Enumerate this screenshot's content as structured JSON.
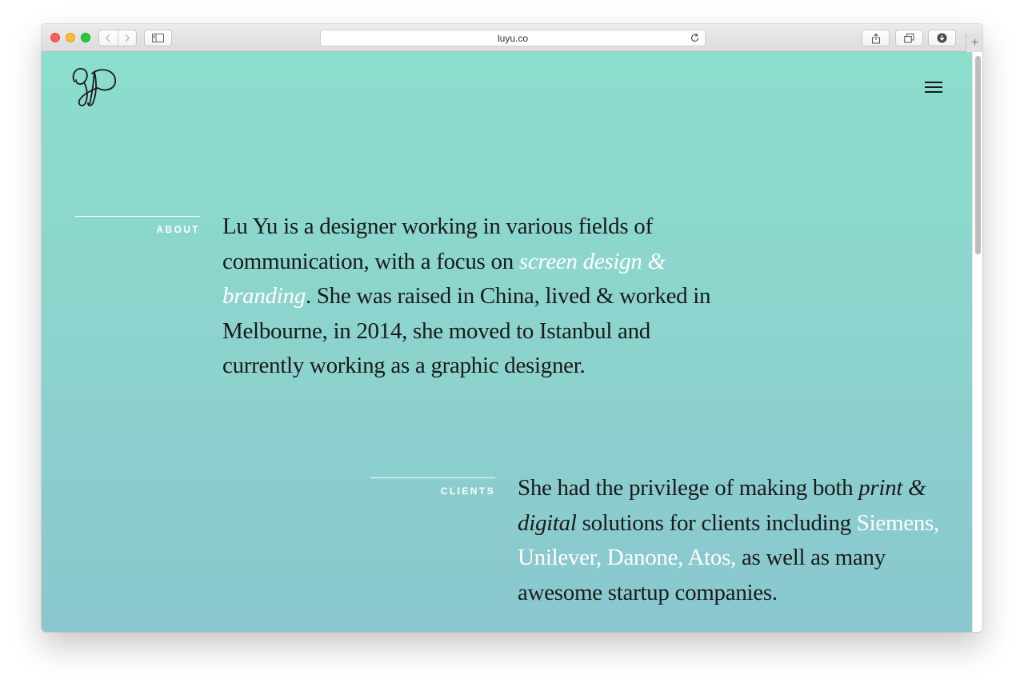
{
  "browser": {
    "url": "luyu.co",
    "new_tab_symbol": "+"
  },
  "site": {
    "menu_icon": "hamburger-menu-icon",
    "logo_icon": "monogram-logo-icon"
  },
  "about": {
    "label": "ABOUT",
    "text_before": "Lu Yu is a designer working in various fields of communication, with a focus on ",
    "highlight": "screen design & branding",
    "text_after": ". She was raised in China, lived & worked in Melbourne, in 2014, she moved to Istanbul and currently working as a graphic designer."
  },
  "clients": {
    "label": "CLIENTS",
    "text_before": "She had the privilege of making both ",
    "emphasis": "print & digital",
    "text_middle": " solutions for clients including ",
    "highlight": "Siemens, Unilever, Danone, Atos,",
    "text_after": " as well as many awesome startup companies."
  },
  "colors": {
    "background_top": "#8cdecd",
    "background_bottom": "#8ac7cf",
    "text": "#1a1a1a",
    "highlight": "#ffffff"
  }
}
